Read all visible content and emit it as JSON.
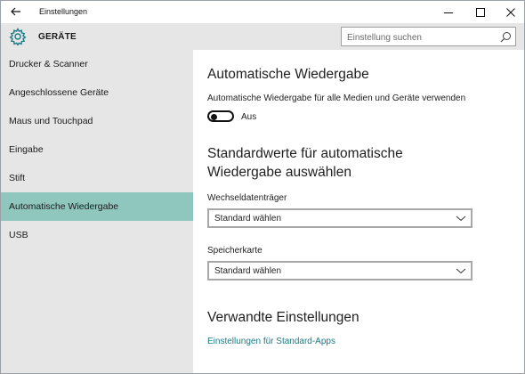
{
  "window": {
    "title": "Einstellungen"
  },
  "header": {
    "section_title": "GERÄTE",
    "search_placeholder": "Einstellung suchen"
  },
  "sidebar": {
    "items": [
      {
        "label": "Drucker & Scanner",
        "active": false
      },
      {
        "label": "Angeschlossene Geräte",
        "active": false
      },
      {
        "label": "Maus und Touchpad",
        "active": false
      },
      {
        "label": "Eingabe",
        "active": false
      },
      {
        "label": "Stift",
        "active": false
      },
      {
        "label": "Automatische Wiedergabe",
        "active": true
      },
      {
        "label": "USB",
        "active": false
      }
    ]
  },
  "content": {
    "autoplay_heading": "Automatische Wiedergabe",
    "autoplay_toggle_label": "Automatische Wiedergabe für alle Medien und Geräte verwenden",
    "autoplay_toggle_state": "Aus",
    "defaults_heading_line1": "Standardwerte für automatische",
    "defaults_heading_line2": "Wiedergabe auswählen",
    "removable_label": "Wechseldatenträger",
    "removable_value": "Standard wählen",
    "memory_card_label": "Speicherkarte",
    "memory_card_value": "Standard wählen",
    "related_heading": "Verwandte Einstellungen",
    "related_link": "Einstellungen für Standard-Apps"
  },
  "colors": {
    "accent_active": "#8fc7bf",
    "link": "#1a7a85",
    "sidebar_bg": "#e6e6e6"
  }
}
